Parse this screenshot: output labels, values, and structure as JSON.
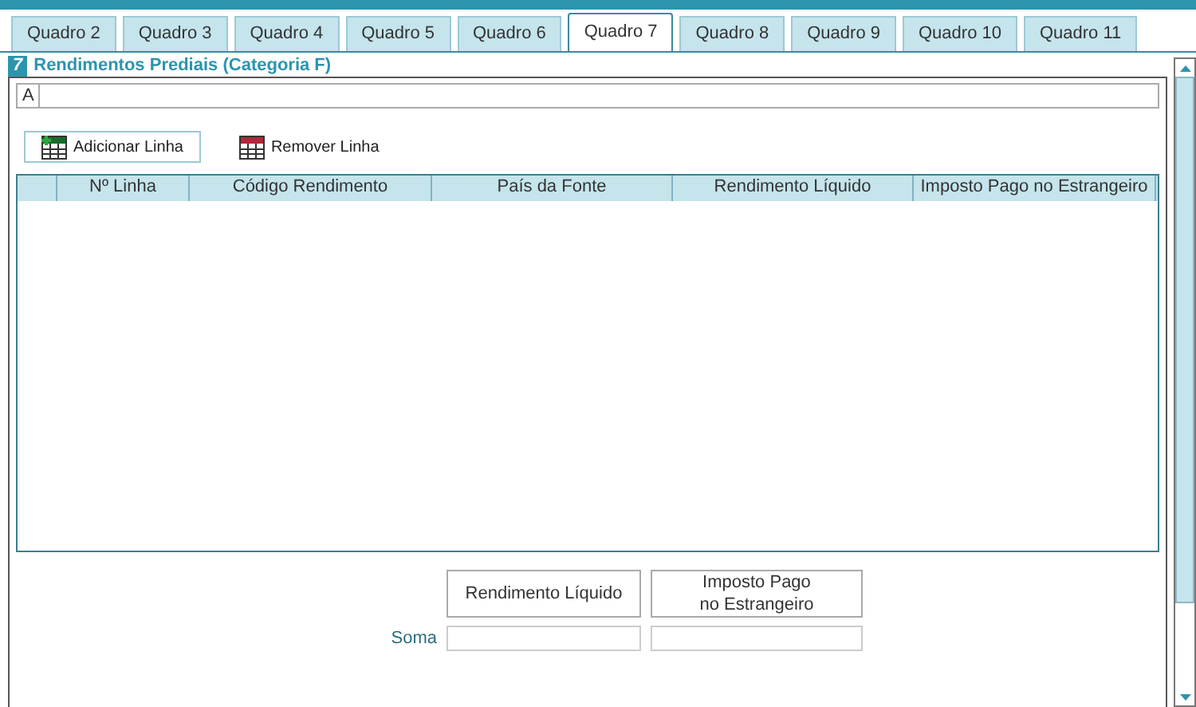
{
  "tabs": [
    {
      "label": "Quadro 2",
      "selected": false
    },
    {
      "label": "Quadro 3",
      "selected": false
    },
    {
      "label": "Quadro 4",
      "selected": false
    },
    {
      "label": "Quadro 5",
      "selected": false
    },
    {
      "label": "Quadro 6",
      "selected": false
    },
    {
      "label": "Quadro 7",
      "selected": true
    },
    {
      "label": "Quadro 8",
      "selected": false
    },
    {
      "label": "Quadro 9",
      "selected": false
    },
    {
      "label": "Quadro 10",
      "selected": false
    },
    {
      "label": "Quadro 11",
      "selected": false
    }
  ],
  "section": {
    "number": "7",
    "title": "Rendimentos Prediais (Categoria F)"
  },
  "field_a": {
    "label": "A"
  },
  "toolbar": [
    {
      "kind": "add",
      "label": "Adicionar Linha"
    },
    {
      "kind": "remove",
      "label": "Remover Linha"
    }
  ],
  "table": {
    "columns": [
      "",
      "Nº Linha",
      "Código Rendimento",
      "País da Fonte",
      "Rendimento Líquido",
      "Imposto Pago no Estrangeiro"
    ]
  },
  "totals": {
    "columns": [
      "Rendimento Líquido",
      "Imposto Pago\nno Estrangeiro"
    ],
    "row_label": "Soma"
  }
}
